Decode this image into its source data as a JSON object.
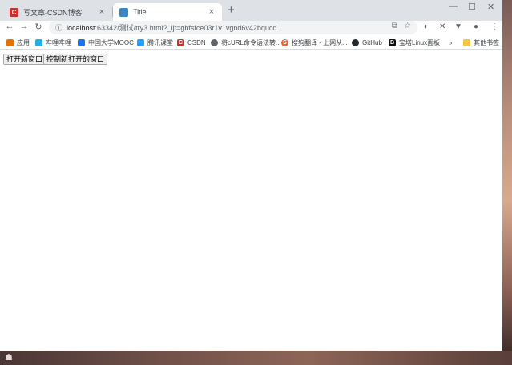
{
  "tabs": [
    {
      "title": "写文章-CSDN博客",
      "active": false
    },
    {
      "title": "Title",
      "active": true
    }
  ],
  "omnibox": {
    "host": "localhost",
    "rest": ":63342/测试/try3.html?_ijt=gbfsfce03r1v1vgnd6v42bqucd"
  },
  "bookmarks": [
    {
      "label": "应用",
      "icon": "apps-grid-icon",
      "color": "#e37400"
    },
    {
      "label": "哔哩哔哩",
      "icon": "bilibili-icon",
      "color": "#23ade5"
    },
    {
      "label": "中国大学MOOC",
      "icon": "mooc-icon",
      "color": "#1a73e8"
    },
    {
      "label": "腾讯课堂",
      "icon": "tencent-classroom-icon",
      "color": "#20a0ff"
    },
    {
      "label": "CSDN",
      "icon": "csdn-icon",
      "color": "#c9302c"
    },
    {
      "label": "将cURL命令语法转...",
      "icon": "globe-icon",
      "color": "#5f6368"
    },
    {
      "label": "搜狗翻译 - 上网从...",
      "icon": "sogou-icon",
      "color": "#f25d2b"
    },
    {
      "label": "GitHub",
      "icon": "github-icon",
      "color": "#24292e"
    },
    {
      "label": "宝塔Linux面板",
      "icon": "bt-icon",
      "color": "#111111"
    },
    {
      "label": "其他书签",
      "icon": "folder-icon",
      "color": "#f4c542"
    }
  ],
  "page": {
    "buttons": [
      "打开新窗口",
      "控制新打开的窗口"
    ]
  },
  "colors": {
    "tabstrip": "#dee1e6",
    "omnibox": "#f1f3f4",
    "csdn": "#c9302c"
  }
}
